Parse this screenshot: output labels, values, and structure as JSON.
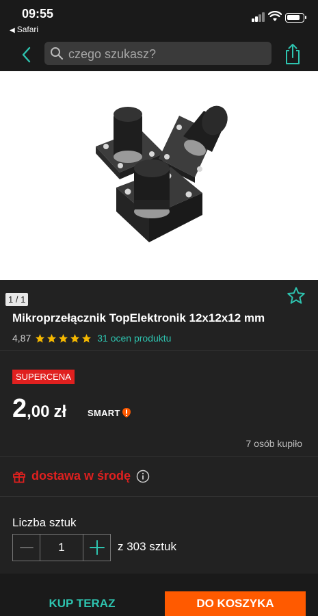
{
  "status_bar": {
    "time": "09:55",
    "back_app": "Safari"
  },
  "nav": {
    "search_placeholder": "czego szukasz?"
  },
  "product": {
    "image_counter": "1 / 1",
    "title": "Mikroprzełącznik TopElektronik 12x12x12 mm",
    "rating_value": "4,87",
    "rating_stars": 5,
    "rating_link": "31 ocen produktu",
    "badge": "SUPERCENA",
    "price_main": "2",
    "price_fraction": ",00",
    "currency": "zł",
    "smart_label": "SMART",
    "bought_text": "7 osób kupiło",
    "delivery_text": "dostawa w środę",
    "quantity_label": "Liczba sztuk",
    "quantity_value": "1",
    "quantity_available": "z 303 sztuk"
  },
  "actions": {
    "buy_now": "KUP TERAZ",
    "add_to_cart": "DO KOSZYKA"
  },
  "colors": {
    "accent": "#2ec4b0",
    "cart_button": "#ff5a00",
    "badge": "#e0201f",
    "star": "#f5b800",
    "background": "#222222"
  },
  "icons": [
    "signal-icon",
    "wifi-icon",
    "battery-icon",
    "back-chevron-icon",
    "search-icon",
    "share-icon",
    "favorite-star-icon",
    "rating-star-icon",
    "smart-icon",
    "gift-icon",
    "info-icon",
    "minus-icon",
    "plus-icon"
  ]
}
